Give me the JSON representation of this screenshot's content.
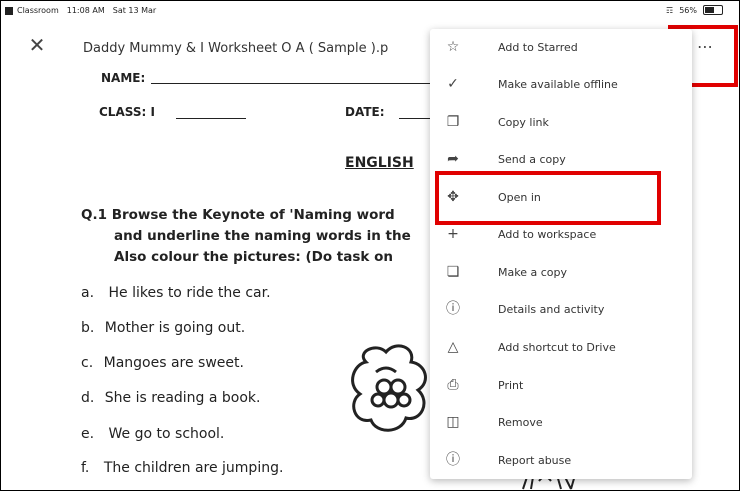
{
  "status_bar": {
    "app": "Classroom",
    "time": "11:08 AM",
    "date": "Sat 13 Mar",
    "battery": "56%"
  },
  "header": {
    "title": "Daddy Mummy & I Worksheet O A ( Sample ).p"
  },
  "document": {
    "name_label": "NAME:",
    "class_label": "CLASS: I",
    "date_label": "DATE:",
    "heading": "ENGLISH",
    "q1_line1": "Q.1 Browse the Keynote of 'Naming word",
    "q1_line2": "and underline the naming words in the",
    "q1_line3": "Also colour the pictures: (Do task on",
    "items": [
      {
        "letter": "a.",
        "text": "He likes to ride the car."
      },
      {
        "letter": "b.",
        "text": "Mother is going out."
      },
      {
        "letter": "c.",
        "text": "Mangoes are sweet."
      },
      {
        "letter": "d.",
        "text": "She is reading a book."
      },
      {
        "letter": "e.",
        "text": "We go to school."
      },
      {
        "letter": "f.",
        "text": "The children are jumping."
      }
    ]
  },
  "menu": {
    "items": [
      {
        "label": "Add to Starred",
        "icon": "star-icon"
      },
      {
        "label": "Make available offline",
        "icon": "offline-icon"
      },
      {
        "label": "Copy link",
        "icon": "copy-link-icon"
      },
      {
        "label": "Send a copy",
        "icon": "send-icon"
      },
      {
        "label": "Open in",
        "icon": "open-in-icon"
      },
      {
        "label": "Add to workspace",
        "icon": "plus-icon"
      },
      {
        "label": "Make a copy",
        "icon": "make-copy-icon"
      },
      {
        "label": "Details and activity",
        "icon": "info-icon"
      },
      {
        "label": "Add shortcut to Drive",
        "icon": "shortcut-icon"
      },
      {
        "label": "Print",
        "icon": "print-icon"
      },
      {
        "label": "Remove",
        "icon": "trash-icon"
      },
      {
        "label": "Report abuse",
        "icon": "report-icon"
      }
    ]
  },
  "colors": {
    "highlight": "#e00000",
    "menu_bg": "#ffffff",
    "text": "#333333"
  }
}
